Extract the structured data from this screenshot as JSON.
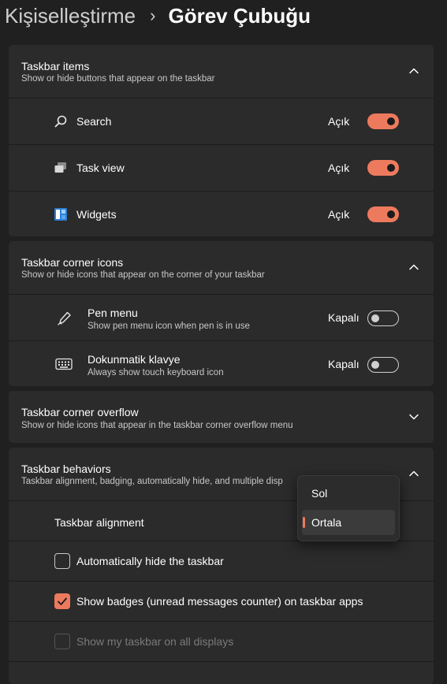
{
  "breadcrumb": {
    "parent": "Kişiselleştirme",
    "separator": "›",
    "current": "Görev Çubuğu"
  },
  "colors": {
    "accent": "#ee7a5e",
    "background": "#202020",
    "card": "#2b2b2b"
  },
  "sections": {
    "taskbar_items": {
      "title": "Taskbar items",
      "subtitle": "Show or hide buttons that appear on the taskbar",
      "expanded": true,
      "rows": [
        {
          "label": "Search",
          "state": "Açık",
          "on": true,
          "icon": "search-icon"
        },
        {
          "label": "Task view",
          "state": "Açık",
          "on": true,
          "icon": "task-view-icon"
        },
        {
          "label": "Widgets",
          "state": "Açık",
          "on": true,
          "icon": "widgets-icon"
        }
      ]
    },
    "corner_icons": {
      "title": "Taskbar corner icons",
      "subtitle": "Show or hide icons that appear on the corner of your taskbar",
      "expanded": true,
      "rows": [
        {
          "label": "Pen menu",
          "sub": "Show pen menu icon when pen is in use",
          "state": "Kapalı",
          "on": false,
          "icon": "pen-icon"
        },
        {
          "label": "Dokunmatik klavye",
          "sub": "Always show touch keyboard icon",
          "state": "Kapalı",
          "on": false,
          "icon": "keyboard-icon"
        }
      ]
    },
    "corner_overflow": {
      "title": "Taskbar corner overflow",
      "subtitle": "Show or hide icons that appear in the taskbar corner overflow menu",
      "expanded": false
    },
    "behaviors": {
      "title": "Taskbar behaviors",
      "subtitle": "Taskbar alignment, badging, automatically hide, and multiple disp",
      "expanded": true,
      "alignment_label": "Taskbar alignment",
      "alignment_options": [
        "Sol",
        "Ortala"
      ],
      "alignment_selected": "Ortala",
      "checks": [
        {
          "label": "Automatically hide the taskbar",
          "checked": false,
          "disabled": false
        },
        {
          "label": "Show badges (unread messages counter) on taskbar apps",
          "checked": true,
          "disabled": false
        },
        {
          "label": "Show my taskbar on all displays",
          "checked": false,
          "disabled": true
        }
      ]
    }
  }
}
